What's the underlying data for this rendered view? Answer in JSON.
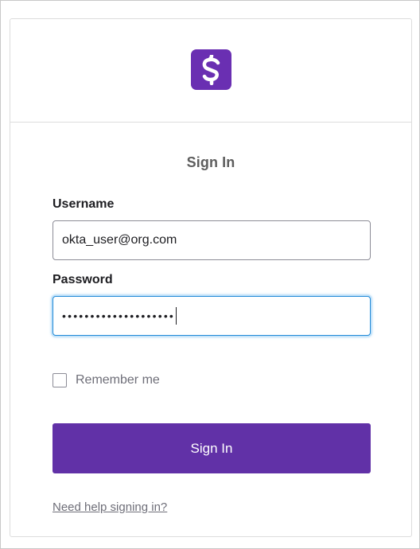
{
  "header": {
    "logo_icon": "purple-dollar-logo-icon",
    "logo_color": "#6a2fb2"
  },
  "form": {
    "title": "Sign In",
    "username_label": "Username",
    "username_value": "okta_user@org.com",
    "password_label": "Password",
    "password_masked": "••••••••••••••••••••",
    "remember_label": "Remember me",
    "remember_checked": false,
    "submit_label": "Sign In",
    "submit_color": "#6131a7",
    "help_link": "Need help signing in?"
  }
}
